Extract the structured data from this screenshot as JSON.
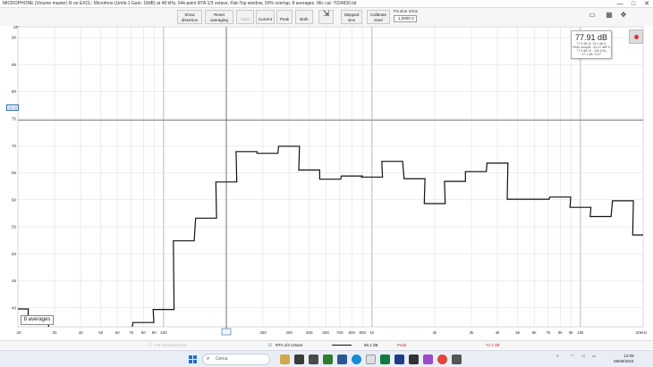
{
  "window": {
    "title": "MICROPHONE (Volume master) R on EXCL: Microfono (Umik-1 Gain: 18dB) at 48 kHz, 64k-point RTA 1/3 octave, Flat-Top window, 50% overlap, 8 averages, Mic cal: 7024830.txt",
    "min": "—",
    "max": "□",
    "close": "✕"
  },
  "toolbar": {
    "show_distortion": [
      "Show",
      "distortion"
    ],
    "reset_averaging": [
      "Reset",
      "averaging"
    ],
    "hold": "Hold",
    "current": "Current",
    "peak": "Peak",
    "both": "Both",
    "stepped_sine": [
      "Stepped",
      "sine"
    ],
    "calibrate_level": [
      "Calibrate",
      "level"
    ],
    "fs_label": "FS sine Vrms",
    "fs_value": "1,0000 V",
    "icons": [
      "monitor-icon",
      "grid-icon",
      "move-icon"
    ]
  },
  "info_box": {
    "value": "77.91 dB",
    "lines": [
      "77.9 dB (C 76.1 dB A",
      "Peak sample: -30.47 dBFS",
      "77.9 dB 22 - 22k (Hz)",
      "47.1 dB +12V"
    ]
  },
  "overlays": {
    "spl_label": "SPL",
    "marker_label": "74,72",
    "averages": "8 averages"
  },
  "status_bar": {
    "for_measurement": "For measurement",
    "rta_mode": "RTA 1/3 octave",
    "level": "65.2 dB",
    "peak_label": "Peak",
    "peak_value": "74.7 dB"
  },
  "taskbar": {
    "search": "Cerca",
    "time": "12:09",
    "date": "08/09/2024"
  },
  "chart_data": {
    "type": "line",
    "title": "",
    "xlabel": "",
    "ylabel": "SPL",
    "x_scale": "log",
    "xlim": [
      20,
      20000
    ],
    "ylim": [
      36.5,
      92
    ],
    "y_ticks": [
      40,
      45,
      50,
      55,
      60,
      65,
      70,
      75,
      80,
      85,
      90
    ],
    "x_ticks": [
      {
        "v": 20,
        "l": "20"
      },
      {
        "v": 30,
        "l": "30"
      },
      {
        "v": 40,
        "l": "40"
      },
      {
        "v": 50,
        "l": "50"
      },
      {
        "v": 60,
        "l": "60"
      },
      {
        "v": 70,
        "l": "70"
      },
      {
        "v": 80,
        "l": "80"
      },
      {
        "v": 90,
        "l": "90"
      },
      {
        "v": 100,
        "l": "100"
      },
      {
        "v": 200,
        "l": "200"
      },
      {
        "v": 300,
        "l": "300"
      },
      {
        "v": 400,
        "l": "400"
      },
      {
        "v": 500,
        "l": "500"
      },
      {
        "v": 600,
        "l": "600"
      },
      {
        "v": 700,
        "l": "700"
      },
      {
        "v": 800,
        "l": "800"
      },
      {
        "v": 900,
        "l": "900"
      },
      {
        "v": 1000,
        "l": "1k"
      },
      {
        "v": 2000,
        "l": "2k"
      },
      {
        "v": 3000,
        "l": "3k"
      },
      {
        "v": 4000,
        "l": "4k"
      },
      {
        "v": 5000,
        "l": "5k"
      },
      {
        "v": 6000,
        "l": "6k"
      },
      {
        "v": 7000,
        "l": "7k"
      },
      {
        "v": 8000,
        "l": "8k"
      },
      {
        "v": 9000,
        "l": "9k"
      },
      {
        "v": 10000,
        "l": "10k"
      },
      {
        "v": 20000,
        "l": "20kHz"
      }
    ],
    "cursor_x": 200,
    "cursor_y": 74.72,
    "series": [
      {
        "name": "RTA 1/3 octave",
        "color": "#111111",
        "bands": [
          {
            "f": 20,
            "v": 39.8
          },
          {
            "f": 25,
            "v": 37.2
          },
          {
            "f": 31.5,
            "v": 32
          },
          {
            "f": 40,
            "v": 32
          },
          {
            "f": 50,
            "v": 35.7
          },
          {
            "f": 63,
            "v": 32
          },
          {
            "f": 80,
            "v": 37.3
          },
          {
            "f": 100,
            "v": 39.7
          },
          {
            "f": 125,
            "v": 52.4
          },
          {
            "f": 160,
            "v": 56.6
          },
          {
            "f": 200,
            "v": 63.3
          },
          {
            "f": 250,
            "v": 68.9
          },
          {
            "f": 315,
            "v": 68.6
          },
          {
            "f": 400,
            "v": 69.9
          },
          {
            "f": 500,
            "v": 65.5
          },
          {
            "f": 630,
            "v": 63.8
          },
          {
            "f": 800,
            "v": 64.4
          },
          {
            "f": 1000,
            "v": 64.2
          },
          {
            "f": 1250,
            "v": 67.1
          },
          {
            "f": 1600,
            "v": 63.9
          },
          {
            "f": 2000,
            "v": 59.3
          },
          {
            "f": 2500,
            "v": 63.4
          },
          {
            "f": 3150,
            "v": 65.2
          },
          {
            "f": 4000,
            "v": 66.8
          },
          {
            "f": 5000,
            "v": 60.1
          },
          {
            "f": 6300,
            "v": 60.1
          },
          {
            "f": 8000,
            "v": 60.5
          },
          {
            "f": 10000,
            "v": 58.6
          },
          {
            "f": 12500,
            "v": 56.9
          },
          {
            "f": 16000,
            "v": 59.8
          },
          {
            "f": 20000,
            "v": 53.5
          }
        ]
      }
    ]
  }
}
